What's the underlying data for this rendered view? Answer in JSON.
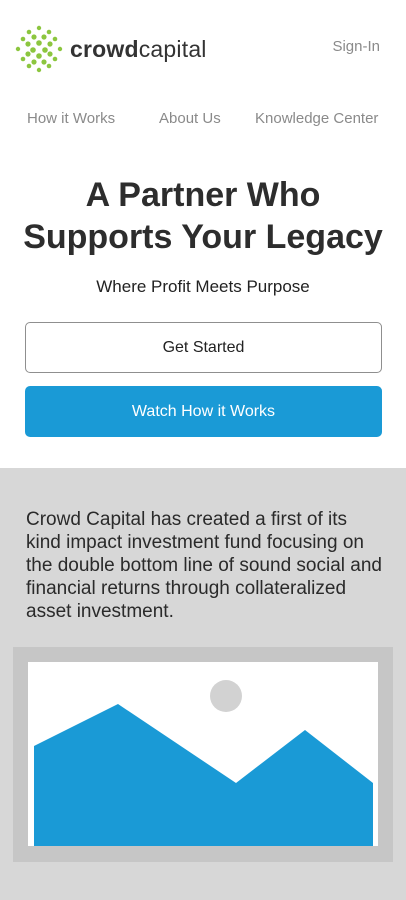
{
  "brand": {
    "name_bold": "crowd",
    "name_light": "capital",
    "accent_color": "#8cc63f"
  },
  "header": {
    "signin_label": "Sign-In"
  },
  "nav": {
    "items": [
      {
        "label": "How it Works"
      },
      {
        "label": "About Us"
      },
      {
        "label": "Knowledge Center"
      }
    ]
  },
  "hero": {
    "title_line1": "A Partner Who",
    "title_line2": "Supports Your Legacy",
    "subtitle": "Where Profit Meets Purpose",
    "primary_cta": "Watch How it Works",
    "secondary_cta": "Get Started",
    "primary_color": "#1a9ad6"
  },
  "about": {
    "description": "Crowd Capital has created a first of its kind impact investment fund focusing on the double bottom line of sound social and financial returns through collateralized asset investment.",
    "image_icon": "image-placeholder-icon"
  }
}
